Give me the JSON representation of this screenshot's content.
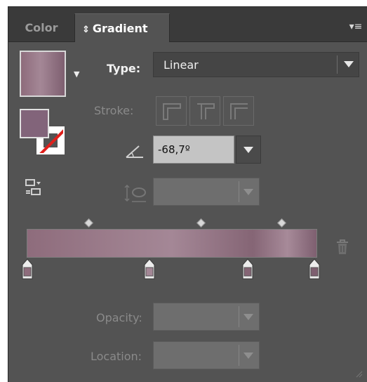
{
  "tabs": [
    {
      "label": "Color"
    },
    {
      "label": "Gradient",
      "active": true
    }
  ],
  "gradient": {
    "type_label": "Type:",
    "type_value": "Linear",
    "stroke_label": "Stroke:",
    "angle_value": "-68,7º",
    "opacity_label": "Opacity:",
    "location_label": "Location:"
  },
  "icons": {
    "tab_arrows": "updown-arrows-icon",
    "panel_menu": "panel-menu-icon",
    "trash": "trash-icon"
  },
  "colors": {
    "panel_bg": "#535353",
    "swatch_mauve": "#8e6c7c",
    "ramp_light": "#a48796",
    "ramp_dark": "#7e5f70",
    "stroke_none": "#e0201c"
  }
}
